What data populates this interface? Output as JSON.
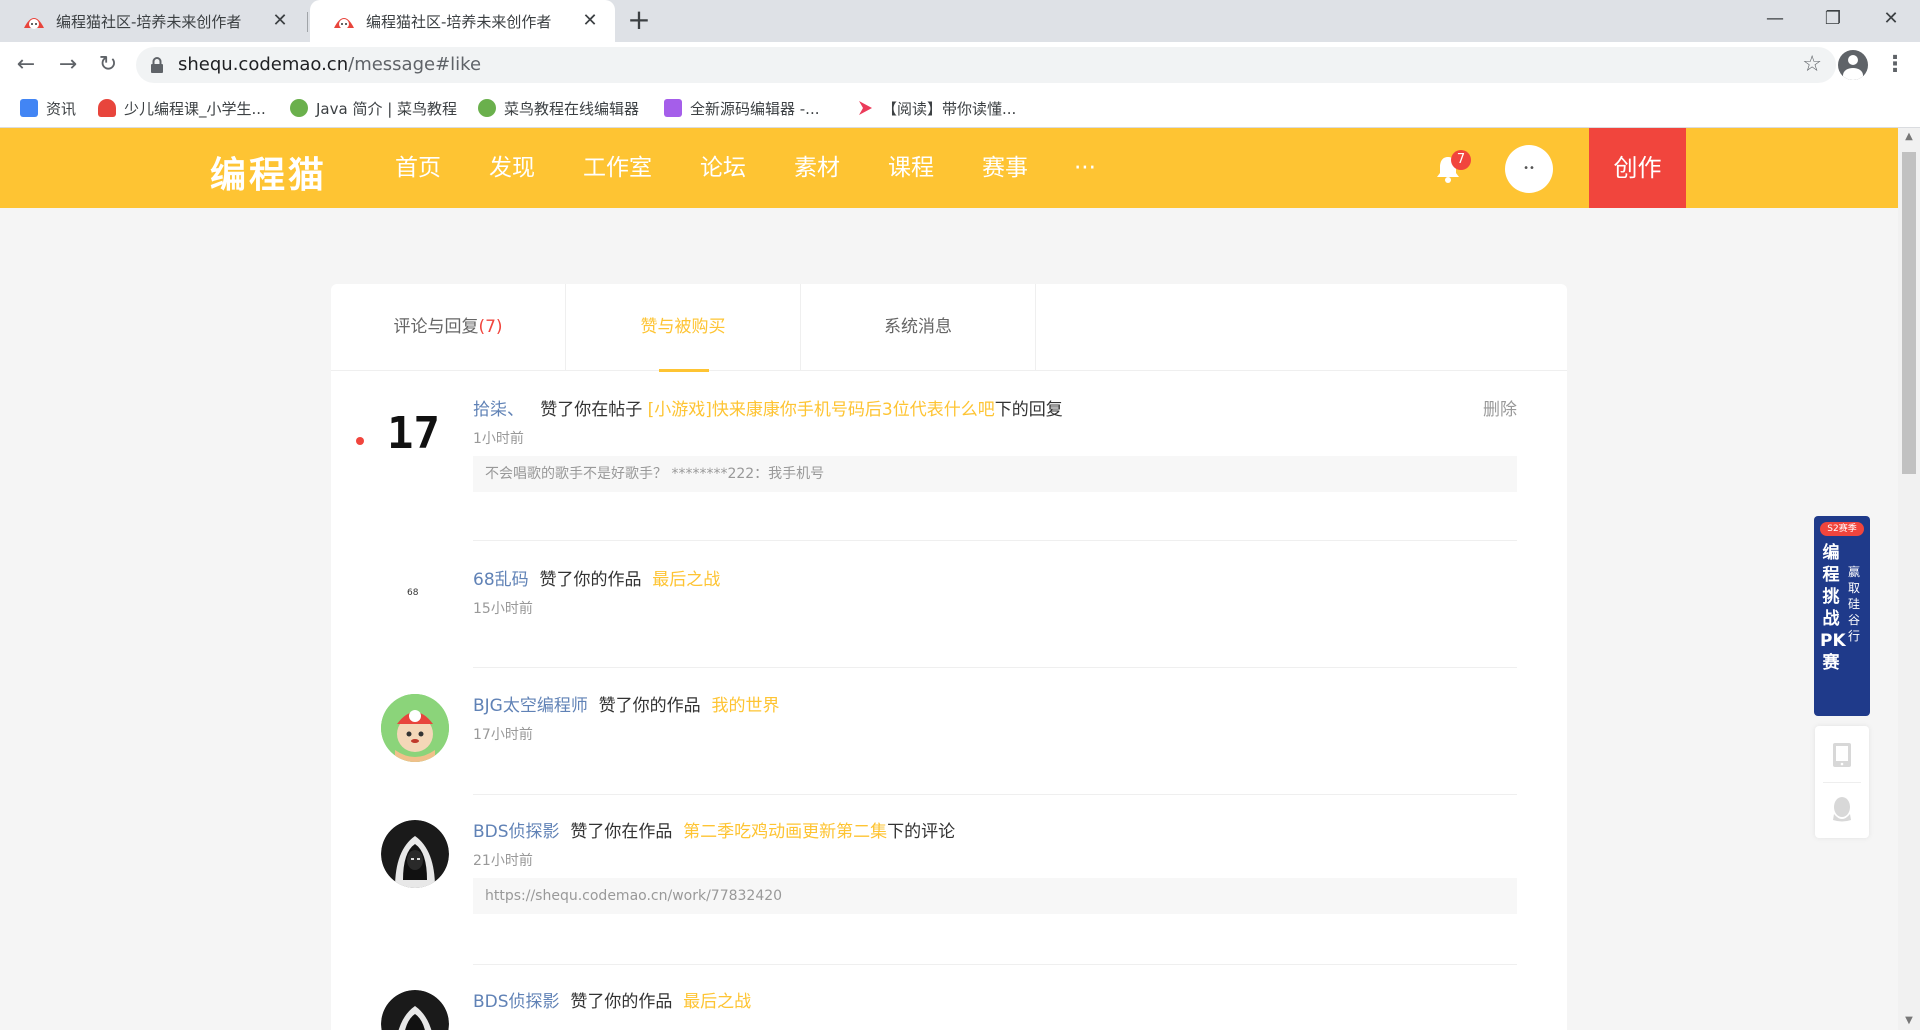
{
  "browser": {
    "tabs": [
      {
        "title": "编程猫社区-培养未来创作者",
        "active": false
      },
      {
        "title": "编程猫社区-培养未来创作者",
        "active": true
      }
    ],
    "close_glyph": "✕",
    "new_tab_glyph": "+",
    "window_controls": {
      "minimize": "—",
      "maximize": "❐",
      "close": "✕"
    },
    "nav": {
      "back": "←",
      "forward": "→",
      "reload": "↻"
    },
    "url_host": "shequ.codemao.cn",
    "url_path": "/message#like",
    "star_glyph": "☆",
    "menu_glyph": "⋮",
    "bookmarks": [
      {
        "label": "资讯",
        "icon": "news-icon",
        "color": "#4285f4"
      },
      {
        "label": "少儿编程课_小学生...",
        "icon": "codemao-icon",
        "color": "#e8453c"
      },
      {
        "label": "Java 简介 | 菜鸟教程",
        "icon": "runoob-icon",
        "color": "#6ab04c"
      },
      {
        "label": "菜鸟教程在线编辑器",
        "icon": "runoob-icon",
        "color": "#6ab04c"
      },
      {
        "label": "全新源码编辑器 -...",
        "icon": "editor-icon",
        "color": "#a55eea"
      },
      {
        "label": "【阅读】带你读懂...",
        "icon": "play-icon",
        "color": "#eb3b5a"
      }
    ]
  },
  "site": {
    "logo": "编程猫",
    "nav": [
      "首页",
      "发现",
      "工作室",
      "论坛",
      "素材",
      "课程",
      "赛事",
      "···"
    ],
    "notification_count": "7",
    "avatar_text": "••",
    "create_label": "创作",
    "colors": {
      "brand": "#fec433",
      "accent": "#f1453d",
      "link": "#6082b6"
    }
  },
  "message_tabs": [
    {
      "label": "评论与回复",
      "count": "(7)"
    },
    {
      "label": "赞与被购买",
      "count": ""
    },
    {
      "label": "系统消息",
      "count": ""
    }
  ],
  "messages": [
    {
      "avatar_text": "17",
      "user": "拾柒、",
      "action": "赞了你在帖子",
      "target": "[小游戏]快来康康你手机号码后3位代表什么吧",
      "suffix": "下的回复",
      "time": "1小时前",
      "quote": "不会唱歌的歌手不是好歌手？ ********222：我手机号",
      "delete_label": "删除",
      "unread": true
    },
    {
      "avatar_text": "68",
      "user": "68乱码",
      "action": "赞了你的作品",
      "target": "最后之战",
      "suffix": "",
      "time": "15小时前",
      "quote": "",
      "delete_label": "",
      "unread": false
    },
    {
      "avatar_text": "",
      "user": "BJG太空编程师",
      "action": "赞了你的作品",
      "target": "我的世界",
      "suffix": "",
      "time": "17小时前",
      "quote": "",
      "delete_label": "",
      "unread": false
    },
    {
      "avatar_text": "",
      "user": "BDS侦探影",
      "action": "赞了你在作品",
      "target": "第二季吃鸡动画更新第二集",
      "suffix": "下的评论",
      "time": "21小时前",
      "quote": "https://shequ.codemao.cn/work/77832420",
      "delete_label": "",
      "unread": false
    },
    {
      "avatar_text": "",
      "user": "BDS侦探影",
      "action": "赞了你的作品",
      "target": "最后之战",
      "suffix": "",
      "time": "",
      "quote": "",
      "delete_label": "",
      "unread": false
    }
  ],
  "promo": {
    "season": "S2赛季",
    "title": "编程挑战PK赛",
    "subtitle": "赢取硅谷行"
  }
}
